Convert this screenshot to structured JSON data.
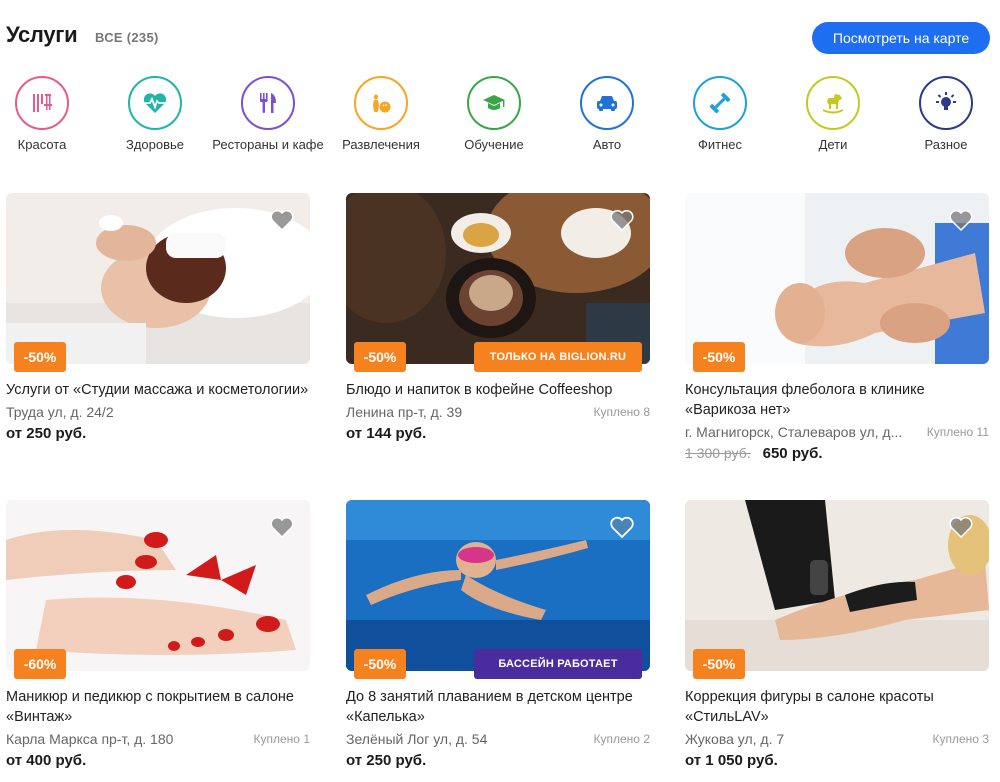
{
  "header": {
    "title": "Услуги",
    "count": "ВСЕ (235)",
    "map_button": "Посмотреть на карте"
  },
  "categories": [
    {
      "label": "Красота",
      "icon": "scissors-comb-icon",
      "color": "#e85a8c"
    },
    {
      "label": "Здоровье",
      "icon": "heart-pulse-icon",
      "color": "#1fb5a8"
    },
    {
      "label": "Рестораны и кафе",
      "icon": "fork-knife-icon",
      "color": "#7d4fd1"
    },
    {
      "label": "Развлечения",
      "icon": "bowling-icon",
      "color": "#f5a623"
    },
    {
      "label": "Обучение",
      "icon": "graduation-cap-icon",
      "color": "#3aa648"
    },
    {
      "label": "Авто",
      "icon": "car-icon",
      "color": "#1e73d8"
    },
    {
      "label": "Фитнес",
      "icon": "dumbbell-icon",
      "color": "#1ba3d9"
    },
    {
      "label": "Дети",
      "icon": "rocking-horse-icon",
      "color": "#c5c81f"
    },
    {
      "label": "Разное",
      "icon": "lightbulb-icon",
      "color": "#2a3a8c"
    }
  ],
  "cards": [
    {
      "title": "Услуги от «Студии массажа и косметологии»",
      "address": "Труда ул, д. 24/2",
      "bought": "",
      "price": "от 250 руб.",
      "old_price": "",
      "discount": "-50%",
      "promo": "",
      "promo_color": "",
      "scene": "spa"
    },
    {
      "title": "Блюдо и напиток в кофейне Coffeeshop",
      "address": "Ленина пр-т, д. 39",
      "bought": "Куплено 8",
      "price": "от 144 руб.",
      "old_price": "",
      "discount": "-50%",
      "promo": "ТОЛЬКО НА BIGLION.RU",
      "promo_color": "#f5811f",
      "scene": "coffee"
    },
    {
      "title": "Консультация флеболога в клинике «Варикоза нет»",
      "address": "г. Магнигорск, Сталеваров ул, д...",
      "bought": "Куплено 11",
      "price": "650 руб.",
      "old_price": "1 300 руб.",
      "discount": "-50%",
      "promo": "",
      "promo_color": "",
      "scene": "doctor"
    },
    {
      "title": "Маникюр и педикюр с покрытием в салоне «Винтаж»",
      "address": "Карла Маркса пр-т, д. 180",
      "bought": "Куплено 1",
      "price": "от 400 руб.",
      "old_price": "",
      "discount": "-60%",
      "promo": "",
      "promo_color": "",
      "scene": "nails"
    },
    {
      "title": "До 8 занятий плаванием в детском центре «Капелька»",
      "address": "Зелёный Лог ул, д. 54",
      "bought": "Куплено 2",
      "price": "от 250 руб.",
      "old_price": "",
      "discount": "-50%",
      "promo": "БАССЕЙН РАБОТАЕТ",
      "promo_color": "#4a2c9e",
      "scene": "pool"
    },
    {
      "title": "Коррекция фигуры в салоне красоты «СтильLAV»",
      "address": "Жукова ул, д. 7",
      "bought": "Куплено 3",
      "price": "от 1 050 руб.",
      "old_price": "",
      "discount": "-50%",
      "promo": "",
      "promo_color": "",
      "scene": "body"
    }
  ]
}
